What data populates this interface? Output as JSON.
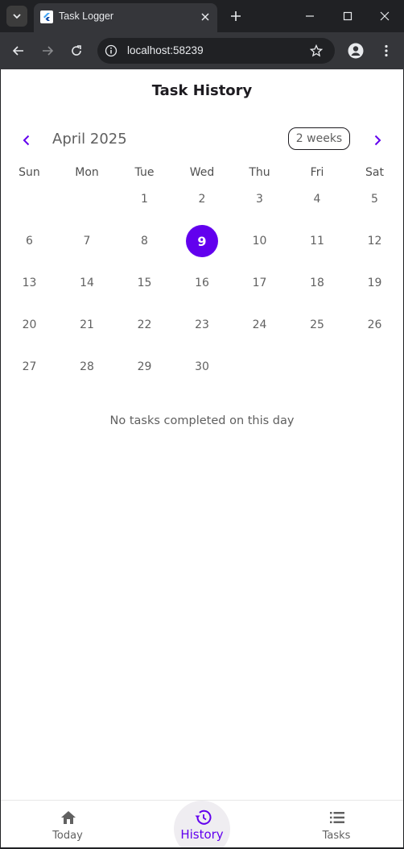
{
  "browser": {
    "tab_title": "Task Logger",
    "url": "localhost:58239"
  },
  "app": {
    "page_title": "Task History",
    "calendar": {
      "month_label": "April 2025",
      "format_button": "2 weeks",
      "weekdays": [
        "Sun",
        "Mon",
        "Tue",
        "Wed",
        "Thu",
        "Fri",
        "Sat"
      ],
      "weeks": [
        [
          "",
          "",
          "1",
          "2",
          "3",
          "4",
          "5"
        ],
        [
          "6",
          "7",
          "8",
          "9",
          "10",
          "11",
          "12"
        ],
        [
          "13",
          "14",
          "15",
          "16",
          "17",
          "18",
          "19"
        ],
        [
          "20",
          "21",
          "22",
          "23",
          "24",
          "25",
          "26"
        ],
        [
          "27",
          "28",
          "29",
          "30",
          "",
          "",
          ""
        ]
      ],
      "selected_day": "9"
    },
    "empty_message": "No tasks completed on this day"
  },
  "bottom_nav": {
    "items": [
      {
        "label": "Today",
        "icon": "home-icon"
      },
      {
        "label": "History",
        "icon": "history-icon"
      },
      {
        "label": "Tasks",
        "icon": "list-icon"
      }
    ],
    "active": "History"
  },
  "colors": {
    "accent": "#6200ee",
    "chrome_dark": "#202124",
    "chrome_toolbar": "#35363a"
  }
}
